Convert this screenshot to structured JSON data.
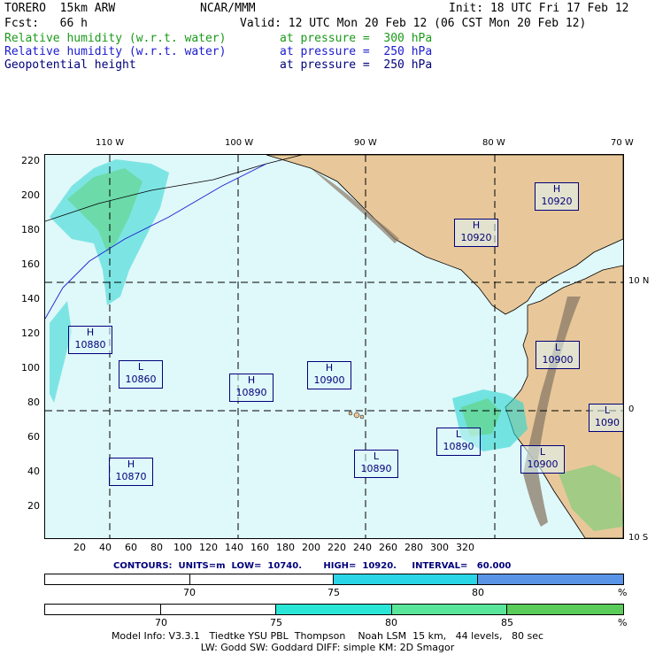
{
  "header": {
    "model": "TORERO  15km ARW",
    "org": "NCAR/MMM",
    "init": "Init: 18 UTC Fri 17 Feb 12",
    "fcst": "Fcst:   66 h",
    "valid": "Valid: 12 UTC Mon 20 Feb 12 (06 CST Mon 20 Feb 12)",
    "fields": [
      {
        "name": "Relative humidity (w.r.t. water)",
        "level": "at pressure =  300 hPa",
        "color": "#1a9a1a"
      },
      {
        "name": "Relative humidity (w.r.t. water)",
        "level": "at pressure =  250 hPa",
        "color": "#1a1ad0"
      },
      {
        "name": "Geopotential height",
        "level": "at pressure =  250 hPa",
        "color": "#00007a"
      }
    ]
  },
  "map": {
    "lon_labels": [
      "110 W",
      "100 W",
      "90 W",
      "80 W",
      "70 W"
    ],
    "lat_labels": [
      "10 N",
      "0",
      "10 S"
    ],
    "y_ticks": [
      "220",
      "200",
      "180",
      "160",
      "140",
      "120",
      "100",
      "80",
      "60",
      "40",
      "20"
    ],
    "x_ticks": [
      "20",
      "40",
      "60",
      "80",
      "100",
      "120",
      "140",
      "160",
      "180",
      "200",
      "220",
      "240",
      "260",
      "280",
      "300",
      "320"
    ],
    "centers": [
      {
        "type": "H",
        "value": "10920"
      },
      {
        "type": "H",
        "value": "10920"
      },
      {
        "type": "H",
        "value": "10880"
      },
      {
        "type": "L",
        "value": "10900"
      },
      {
        "type": "L",
        "value": "10860"
      },
      {
        "type": "H",
        "value": "10890"
      },
      {
        "type": "H",
        "value": "10900"
      },
      {
        "type": "L",
        "value": "1090"
      },
      {
        "type": "L",
        "value": "10890"
      },
      {
        "type": "L",
        "value": "10900"
      },
      {
        "type": "H",
        "value": "10870"
      },
      {
        "type": "L",
        "value": "10890"
      }
    ],
    "colors": {
      "ocean": "#dff8fa",
      "land": "#e8c89a",
      "mountain": "#8a7a66",
      "rh_cyan": "#2ad6d0",
      "rh_green": "#5cd070"
    }
  },
  "contours": {
    "text": "CONTOURS:  UNITS=m  LOW=  10740.       HIGH=  10920.     INTERVAL=   60.000"
  },
  "colorbar_250": {
    "ticks": [
      "70",
      "75",
      "80",
      "%"
    ],
    "colors": [
      "#ffffff",
      "#ffffff",
      "#2ad6e6",
      "#5a94e6"
    ]
  },
  "colorbar_300": {
    "ticks": [
      "70",
      "75",
      "80",
      "85",
      "%"
    ],
    "colors": [
      "#ffffff",
      "#ffffff",
      "#2ae6d6",
      "#5ae69a",
      "#5acc5a"
    ]
  },
  "footer": {
    "line1": "Model Info: V3.3.1   Tiedtke YSU PBL  Thompson    Noah LSM  15 km,   44 levels,   80 sec",
    "line2": "LW: Godd SW: Goddard DIFF: simple KM: 2D Smagor"
  }
}
